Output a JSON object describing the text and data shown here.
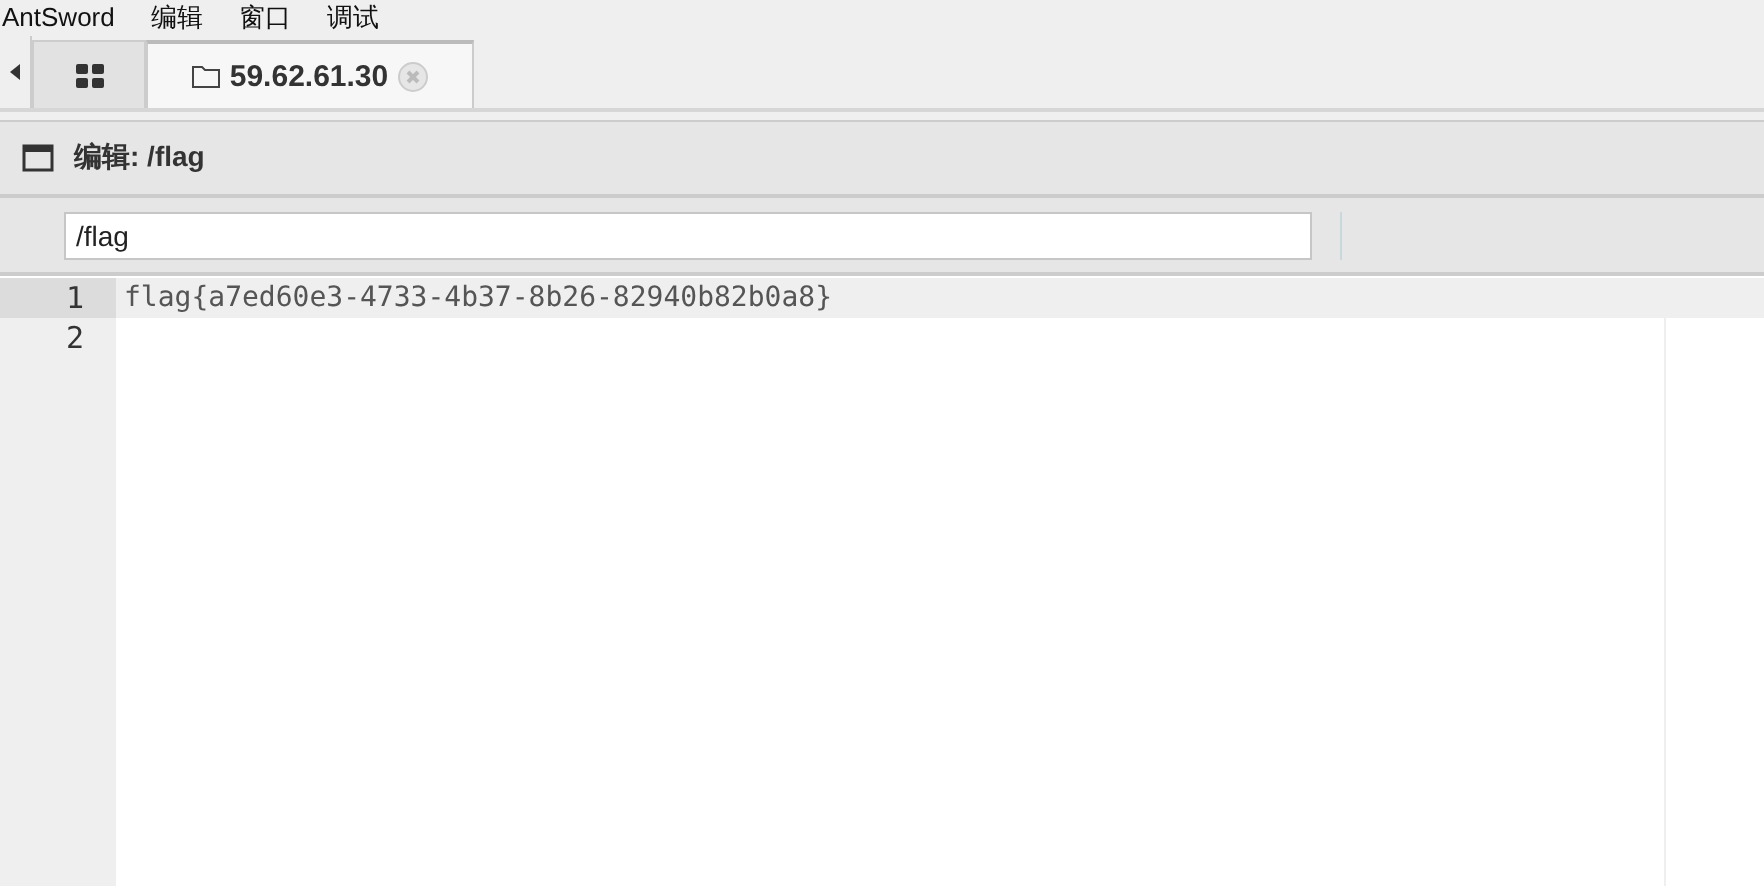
{
  "menu": [
    "AntSword",
    "编辑",
    "窗口",
    "调试"
  ],
  "tabs": [
    {
      "kind": "home",
      "selected": false
    },
    {
      "kind": "host",
      "label": "59.62.61.30",
      "selected": true
    }
  ],
  "panel": {
    "title": "编辑: /flag"
  },
  "path_field": {
    "value": "/flag"
  },
  "editor": {
    "lines": [
      {
        "number": "1",
        "text": "flag{a7ed60e3-4733-4b37-8b26-82940b82b0a8}",
        "active": true
      },
      {
        "number": "2",
        "active": false
      }
    ]
  }
}
